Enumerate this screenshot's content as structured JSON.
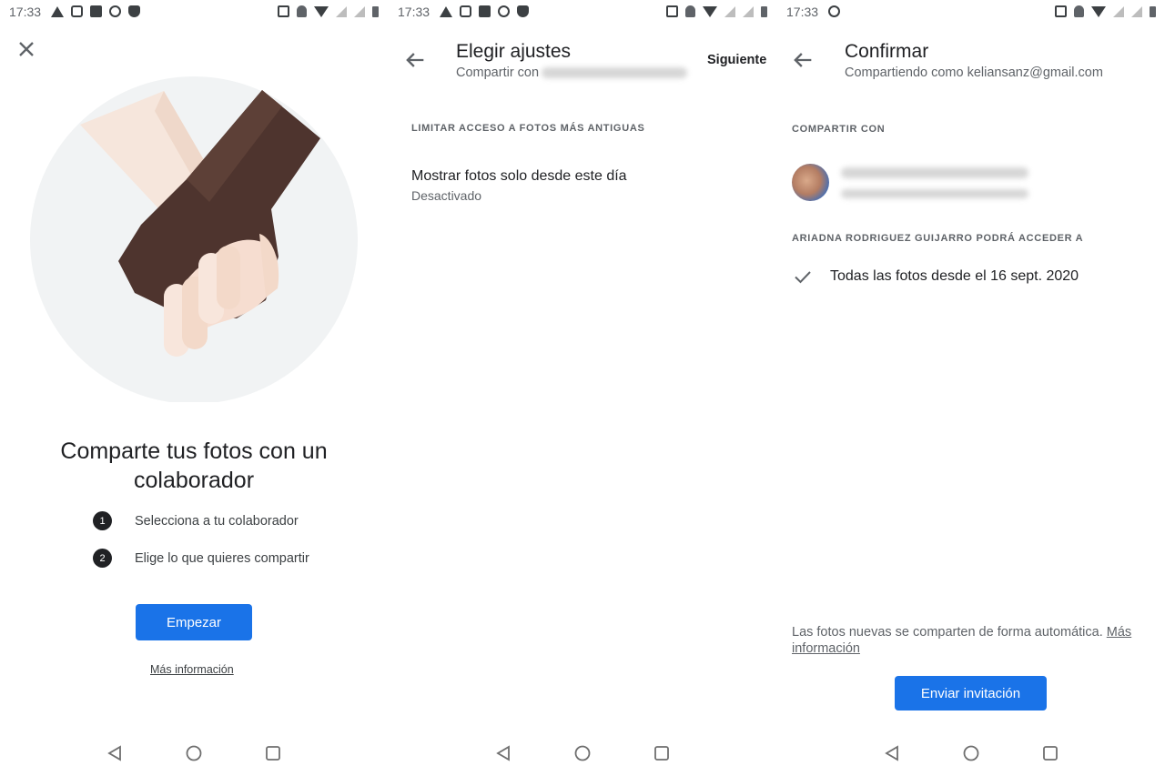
{
  "status_bar": {
    "p1_time": "17:33",
    "p2_time": "17:33",
    "p3_time": "17:33"
  },
  "intro": {
    "headline": "Comparte tus fotos con un colaborador",
    "steps": [
      {
        "num": "1",
        "text": "Selecciona a tu colaborador"
      },
      {
        "num": "2",
        "text": "Elige lo que quieres compartir"
      }
    ],
    "start_button": "Empezar",
    "more_info": "Más información",
    "colors": {
      "accent": "#1a73e8",
      "dark_hand": "#4e342e",
      "light_hand": "#f3d9c9",
      "circle_bg": "#f1f3f4"
    }
  },
  "settings": {
    "title": "Elegir ajustes",
    "subtitle": "Compartir con",
    "next": "Siguiente",
    "section": "LIMITAR ACCESO A FOTOS MÁS ANTIGUAS",
    "option_title": "Mostrar fotos solo desde este día",
    "option_value": "Desactivado"
  },
  "confirm": {
    "title": "Confirmar",
    "subtitle": "Compartiendo como keliansanz@gmail.com",
    "share_with_label": "COMPARTIR CON",
    "access_label": "ARIADNA RODRIGUEZ GUIJARRO PODRÁ ACCEDER A",
    "access_item": "Todas las fotos desde el 16 sept. 2020",
    "footer_text": "Las fotos nuevas se comparten de forma automática.",
    "footer_link": "Más información",
    "send_button": "Enviar invitación"
  }
}
